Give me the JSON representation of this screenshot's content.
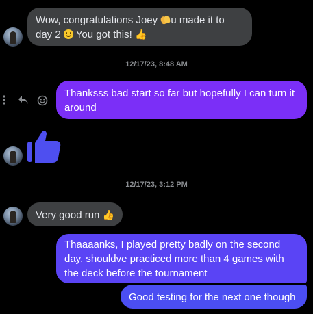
{
  "conversation": {
    "messages": [
      {
        "sender": "contact",
        "text_line1_prefix": "Wow, congratulations Joey ",
        "text_line1_suffix": "u made it to",
        "text_line2_prefix": "day 2 ",
        "text_line2_middle": "  You got this! "
      }
    ],
    "timestamp_1": "12/17/23, 8:48 AM",
    "my_message_1": "Thanksss bad start so far but hopefully I can turn it around",
    "timestamp_2": "12/17/23, 3:12 PM",
    "contact_message_2": "Very good run ",
    "my_message_2": "Thaaaanks, I played pretty badly on the second day, shouldve practiced more than 4 games with the deck before the tournament",
    "my_message_3": "Good testing for the next one though"
  },
  "icons": {
    "more": "more-vertical-icon",
    "reply": "reply-icon",
    "react": "emoji-react-icon",
    "thumbs_up": "thumbs-up-icon",
    "clap": "clapping-hands-emoji",
    "smile": "smiling-face-emoji"
  },
  "colors": {
    "background": "#000000",
    "incoming_bubble": "#3e4042",
    "outgoing_purple": "#7b2ff7",
    "outgoing_blue": "#4b4ef2",
    "thumbs_up_large": "#4e4ff0",
    "timestamp_text": "#8a8d91"
  }
}
